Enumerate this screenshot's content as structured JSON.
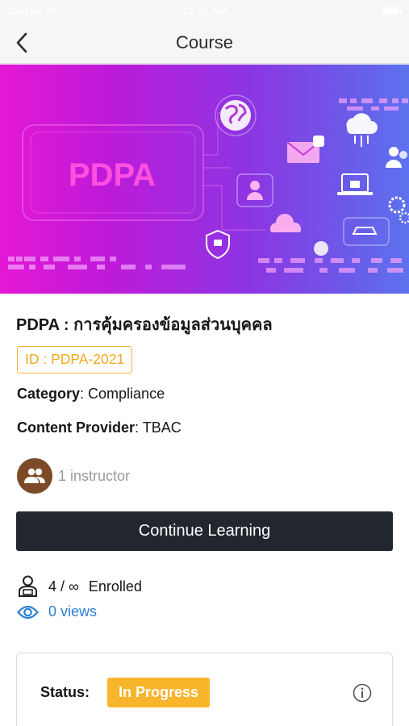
{
  "status_bar": {
    "carrier": "Carrier",
    "time": "12:22 AM"
  },
  "nav": {
    "title": "Course"
  },
  "hero": {
    "banner_text": "PDPA"
  },
  "course": {
    "title": "PDPA : การคุ้มครองข้อมูลส่วนบุคคล",
    "id_label": "ID : PDPA-2021",
    "category_label": "Category",
    "category_value": ": Compliance",
    "provider_label": "Content Provider",
    "provider_value": ": TBAC",
    "instructor_text": "1 instructor"
  },
  "actions": {
    "continue_label": "Continue Learning"
  },
  "stats": {
    "enrolled_count": "4 / ∞",
    "enrolled_label": "Enrolled",
    "views_text": "0 views"
  },
  "status": {
    "label": "Status:",
    "value": "In Progress"
  },
  "colors": {
    "accent_orange": "#f8b52b",
    "link_blue": "#2d7fd0",
    "button_dark": "#22262e",
    "avatar_brown": "#7b4a26"
  }
}
